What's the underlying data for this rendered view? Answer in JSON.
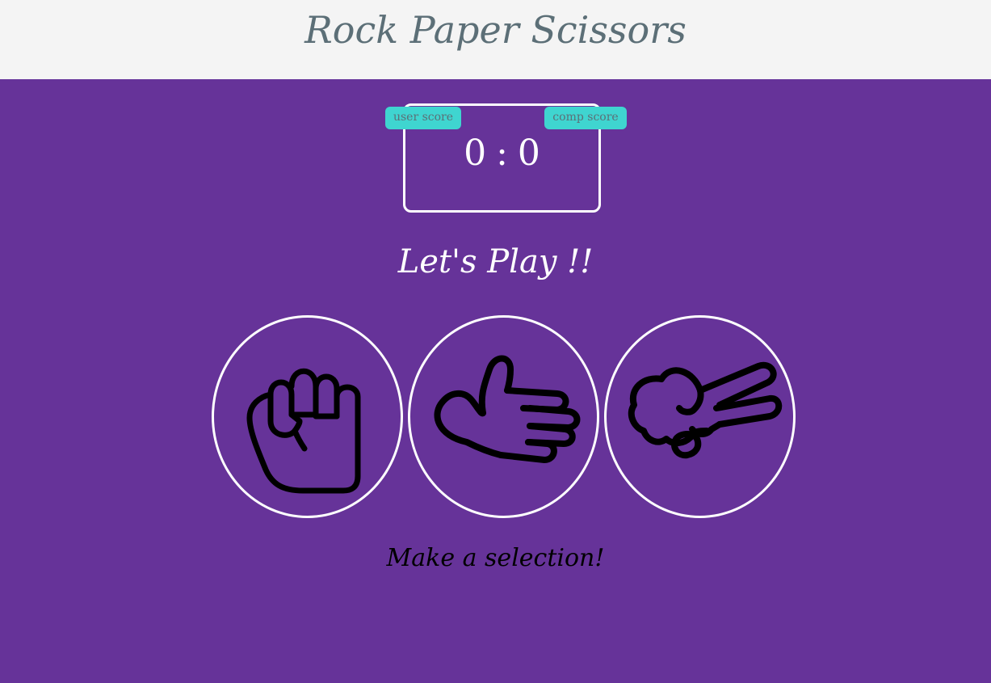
{
  "header": {
    "title": "Rock Paper Scissors"
  },
  "scoreboard": {
    "user_label": "user score",
    "comp_label": "comp score",
    "user_score": "0",
    "separator": ":",
    "comp_score": "0"
  },
  "result": {
    "text": "Let's Play !!"
  },
  "choices": [
    {
      "id": "rock",
      "icon": "hand-fist-icon"
    },
    {
      "id": "paper",
      "icon": "hand-open-icon"
    },
    {
      "id": "scissors",
      "icon": "hand-scissors-icon"
    }
  ],
  "action_message": {
    "text": "Make a selection!"
  },
  "colors": {
    "background": "#663399",
    "header_background": "#f4f4f4",
    "badge": "#3fd5d0",
    "title_text": "#5c6f77",
    "border": "#ffffff"
  }
}
